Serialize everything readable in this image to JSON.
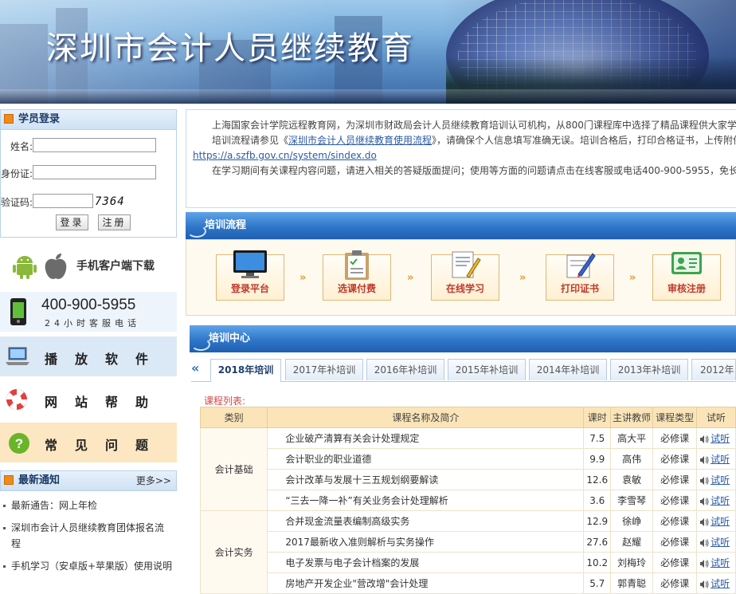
{
  "banner": {
    "title": "深圳市会计人员继续教育"
  },
  "login": {
    "header": "学员登录",
    "name_label": "姓名:",
    "id_label": "身份证:",
    "captcha_label": "验证码:",
    "captcha_code": "7364",
    "login_button": "登录",
    "register_button": "注册"
  },
  "sidebar": {
    "mobile_download": "手机客户端下载",
    "hotline_number": "400-900-5955",
    "hotline_caption": "24小时客服电话",
    "player": "播放软件",
    "help": "网站帮助",
    "faq": "常见问题"
  },
  "news": {
    "header": "最新通知",
    "more": "更多>>",
    "items": [
      "最新通告：网上年检",
      "深圳市会计人员继续教育团体报名流程",
      "手机学习（安卓版+苹果版）使用说明"
    ]
  },
  "intro": {
    "p1": "上海国家会计学院远程教育网，为深圳市财政局会计人员继续教育培训认可机构，从800门课程库中选择了精品课程供大家学习。",
    "p2_pre": "培训流程请参见《",
    "p2_link": "深圳市会计人员继续教育使用流程",
    "p2_post": "》，请确保个人信息填写准确无误。培训合格后，打印合格证书，上传附件进行网上年检，网上年检地址：",
    "p2_url": "https://a.szfb.gov.cn/system/sindex.do",
    "p3": "在学习期间有关课程内容问题，请进入相关的答疑版面提问；使用等方面的问题请点击在线客服或电话400-900-5955，免长途电话了解。"
  },
  "flow": {
    "header": "培训流程",
    "steps": [
      "登录平台",
      "选课付费",
      "在线学习",
      "打印证书",
      "审核注册"
    ],
    "arrow": "»"
  },
  "center": {
    "header": "培训中心",
    "prev": "«",
    "tabs": [
      "2018年培训",
      "2017年补培训",
      "2016年补培训",
      "2015年补培训",
      "2014年补培训",
      "2013年补培训",
      "2012年"
    ],
    "course_list_label": "课程列表:",
    "columns": [
      "类别",
      "课程名称及简介",
      "课时",
      "主讲教师",
      "课程类型",
      "试听"
    ],
    "groups": [
      {
        "category": "会计基础",
        "rows": [
          {
            "name": "企业破产清算有关会计处理规定",
            "hours": "7.5",
            "teacher": "高大平",
            "type": "必修课",
            "listen": "试听"
          },
          {
            "name": "会计职业的职业道德",
            "hours": "9.9",
            "teacher": "高伟",
            "type": "必修课",
            "listen": "试听"
          },
          {
            "name": "会计改革与发展十三五规划纲要解读",
            "hours": "12.6",
            "teacher": "袁敏",
            "type": "必修课",
            "listen": "试听"
          },
          {
            "name": "“三去一降一补”有关业务会计处理解析",
            "hours": "3.6",
            "teacher": "李雪琴",
            "type": "必修课",
            "listen": "试听"
          }
        ]
      },
      {
        "category": "会计实务",
        "rows": [
          {
            "name": "合并现金流量表编制高级实务",
            "hours": "12.9",
            "teacher": "徐峥",
            "type": "必修课",
            "listen": "试听"
          },
          {
            "name": "2017最新收入准则解析与实务操作",
            "hours": "27.6",
            "teacher": "赵耀",
            "type": "必修课",
            "listen": "试听"
          },
          {
            "name": "电子发票与电子会计档案的发展",
            "hours": "10.2",
            "teacher": "刘梅玲",
            "type": "必修课",
            "listen": "试听"
          },
          {
            "name": "房地产开发企业\"营改增\"会计处理",
            "hours": "5.7",
            "teacher": "郭青聪",
            "type": "必修课",
            "listen": "试听"
          }
        ]
      }
    ]
  },
  "colors": {
    "accent_blue": "#2f76c9",
    "accent_orange": "#f08a1d",
    "step_text": "#c0392b",
    "table_header": "#fbe4b8"
  }
}
